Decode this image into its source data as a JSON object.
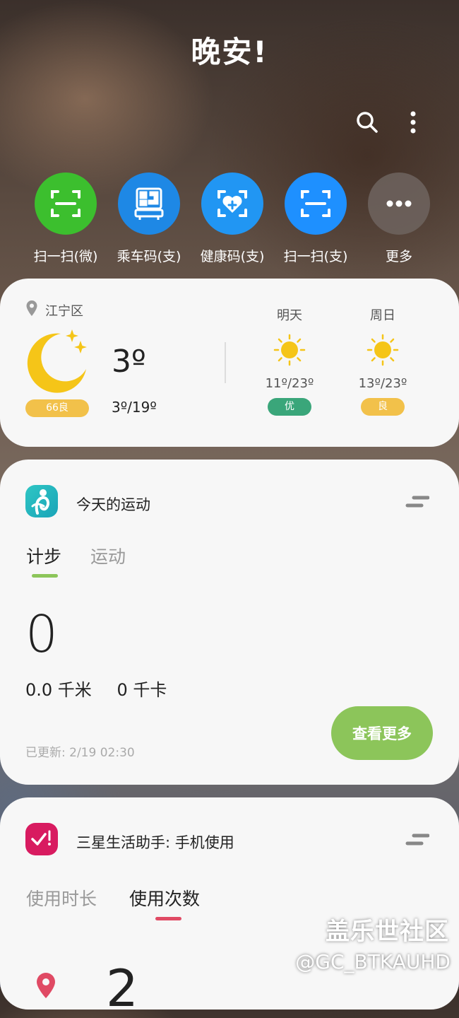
{
  "header": {
    "greeting": "晚安!"
  },
  "top_actions": [
    {
      "icon": "search-icon"
    },
    {
      "icon": "more-vert-icon"
    }
  ],
  "shortcuts": [
    {
      "label": "扫一扫(微)",
      "icon": "scan-icon",
      "color": "#3cbf2e"
    },
    {
      "label": "乘车码(支)",
      "icon": "bus-qr-icon",
      "color": "#1e88e5"
    },
    {
      "label": "健康码(支)",
      "icon": "health-code-icon",
      "color": "#2196f3"
    },
    {
      "label": "扫一扫(支)",
      "icon": "scan-icon",
      "color": "#1e90ff"
    },
    {
      "label": "更多",
      "icon": "more-horiz-icon",
      "color": "#6b6460"
    }
  ],
  "weather": {
    "location": "江宁区",
    "current_temp": "3º",
    "range": "3º/19º",
    "aqi": "66良",
    "forecast": [
      {
        "day": "明天",
        "range": "11º/23º",
        "aqi": "优",
        "aqi_color": "#3aa67a"
      },
      {
        "day": "周日",
        "range": "13º/23º",
        "aqi": "良",
        "aqi_color": "#f2c14a"
      }
    ]
  },
  "fitness": {
    "title": "今天的运动",
    "tabs": [
      "计步",
      "运动"
    ],
    "steps": "0",
    "distance": "0.0 千米",
    "calories": "0 千卡",
    "updated": "已更新:  2/19 02:30",
    "button": "查看更多",
    "accent": "#8cc55a"
  },
  "usage": {
    "title": "三星生活助手: 手机使用",
    "tabs": [
      "使用时长",
      "使用次数"
    ],
    "count": "2",
    "accent": "#e04a64"
  },
  "watermark": {
    "line1": "盖乐世社区",
    "line2": "@GC_BTKAUHD"
  }
}
